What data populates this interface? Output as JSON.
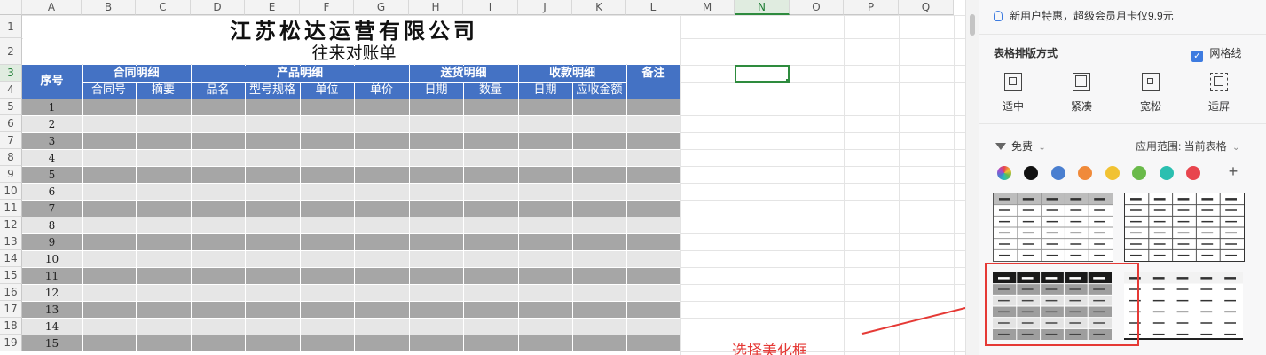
{
  "sheet": {
    "columns": [
      "A",
      "B",
      "C",
      "D",
      "E",
      "F",
      "G",
      "H",
      "I",
      "J",
      "K",
      "L",
      "M",
      "N",
      "O",
      "P",
      "Q"
    ],
    "selected_column": "N",
    "rows": [
      "1",
      "2",
      "3",
      "4",
      "5",
      "6",
      "7",
      "8",
      "9",
      "10",
      "11",
      "12",
      "13",
      "14",
      "15",
      "16",
      "17",
      "18",
      "19"
    ],
    "selected_row": "3",
    "title": "江苏松达运营有限公司",
    "subtitle": "往来对账单",
    "header_groups": {
      "seq": "序号",
      "contract": "合同明细",
      "product": "产品明细",
      "delivery": "送货明细",
      "payment": "收款明细",
      "remark": "备注"
    },
    "header_subs": {
      "contract_no": "合同号",
      "summary": "摘要",
      "name": "品名",
      "model": "型号规格",
      "unit": "单位",
      "price": "单价",
      "delivery_date": "日期",
      "qty": "数量",
      "pay_date": "日期",
      "amount": "应收金额"
    },
    "seq_numbers": [
      "1",
      "2",
      "3",
      "4",
      "5",
      "6",
      "7",
      "8",
      "9",
      "10",
      "11",
      "12",
      "13",
      "14",
      "15"
    ],
    "colors": {
      "header_blue": "#4472c4",
      "band_dark": "#a6a6a6",
      "band_light": "#e6e6e6",
      "selection_green": "#2e8b3e"
    }
  },
  "panel": {
    "promo": "新用户特惠，超级会员月卡仅9.9元",
    "section_title": "表格排版方式",
    "gridlines_label": "网格线",
    "gridlines_checked": true,
    "layouts": [
      "适中",
      "紧凑",
      "宽松",
      "适屏"
    ],
    "price_filter": "免费",
    "apply_scope": "应用范围: 当前表格",
    "swatch_colors": [
      "rainbow",
      "#111111",
      "#4a7fd0",
      "#f08a3a",
      "#f1c232",
      "#6aba4a",
      "#2bbfb0",
      "#e8454e"
    ],
    "add_label": "+"
  },
  "annotation": {
    "text": "选择美化框",
    "color": "#e53935"
  }
}
